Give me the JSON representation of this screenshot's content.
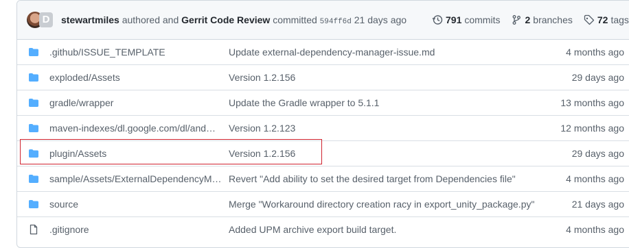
{
  "commit": {
    "author": "stewartmiles",
    "authored_and": "authored and",
    "committer": "Gerrit Code Review",
    "committed": "committed",
    "sha": "594ff6d",
    "time": "21 days ago"
  },
  "stats": {
    "commits_count": "791",
    "commits_label": "commits",
    "branches_count": "2",
    "branches_label": "branches",
    "tags_count": "72",
    "tags_label": "tags"
  },
  "files": [
    {
      "icon": "folder-icon",
      "name_dim": ".github/",
      "name_main": "ISSUE_TEMPLATE",
      "message": "Update external-dependency-manager-issue.md",
      "age": "4 months ago"
    },
    {
      "icon": "folder-icon",
      "name_dim": "exploded/",
      "name_main": "Assets",
      "message": "Version 1.2.156",
      "age": "29 days ago"
    },
    {
      "icon": "folder-icon",
      "name_dim": "gradle/",
      "name_main": "wrapper",
      "message": "Update the Gradle wrapper to 5.1.1",
      "age": "13 months ago"
    },
    {
      "icon": "folder-icon",
      "name_dim": "maven-indexes/dl.google.com/dl/and…",
      "name_main": "",
      "message": "Version 1.2.123",
      "age": "12 months ago"
    },
    {
      "icon": "folder-icon",
      "name_dim": "plugin/",
      "name_main": "Assets",
      "message": "Version 1.2.156",
      "age": "29 days ago"
    },
    {
      "icon": "folder-icon",
      "name_dim": "sample/Assets/ExternalDependencyM…",
      "name_main": "",
      "message": "Revert \"Add ability to set the desired target from Dependencies file\"",
      "age": "4 months ago"
    },
    {
      "icon": "folder-icon",
      "name_dim": "",
      "name_main": "source",
      "message": "Merge \"Workaround directory creation racy in export_unity_package.py\"",
      "age": "21 days ago"
    },
    {
      "icon": "file-icon",
      "name_dim": "",
      "name_main": ".gitignore",
      "message": "Added UPM archive export build target.",
      "age": "4 months ago"
    }
  ],
  "colors": {
    "folder": "#54aeff",
    "file": "#57606a",
    "highlight": "#cf222e"
  }
}
